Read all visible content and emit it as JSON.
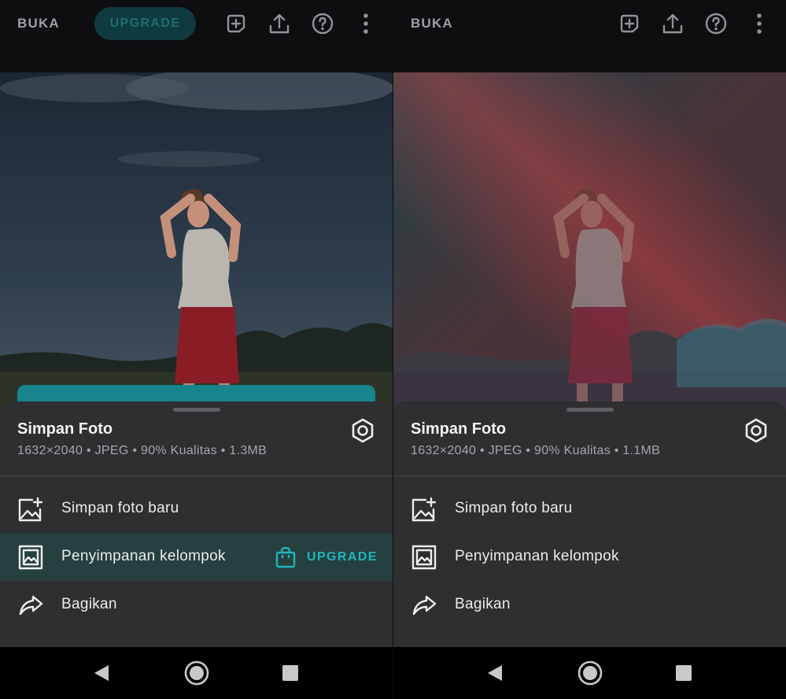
{
  "left": {
    "toolbar": {
      "open_label": "BUKA",
      "upgrade_label": "UPGRADE"
    },
    "save_sheet": {
      "title": "Simpan Foto",
      "subtitle": "1632×2040 • JPEG • 90% Kualitas • 1.3MB",
      "options": [
        {
          "label": "Simpan foto baru",
          "icon": "add-photo-icon"
        },
        {
          "label": "Penyimpanan kelompok",
          "icon": "gallery-icon",
          "badge": "UPGRADE",
          "badge_icon": "shopping-bag-icon",
          "highlighted": true
        },
        {
          "label": "Bagikan",
          "icon": "share-arrow-icon"
        }
      ]
    }
  },
  "right": {
    "toolbar": {
      "open_label": "BUKA"
    },
    "save_sheet": {
      "title": "Simpan Foto",
      "subtitle": "1632×2040 • JPEG • 90% Kualitas • 1.1MB",
      "options": [
        {
          "label": "Simpan foto baru",
          "icon": "add-photo-icon"
        },
        {
          "label": "Penyimpanan kelompok",
          "icon": "gallery-icon"
        },
        {
          "label": "Bagikan",
          "icon": "share-arrow-icon"
        }
      ]
    }
  },
  "icons": {
    "toolbar": [
      "add-layer-icon",
      "export-icon",
      "help-icon",
      "more-vert-icon"
    ],
    "sheet": [
      "settings-gear-icon"
    ],
    "nav": [
      "back-triangle-icon",
      "home-circle-icon",
      "recents-square-icon"
    ]
  },
  "colors": {
    "accent_teal": "#1fb5bd",
    "sheet_background": "#2e2f31",
    "highlight_row": "#25403f",
    "upgrade_pill": "#0f3b40"
  }
}
